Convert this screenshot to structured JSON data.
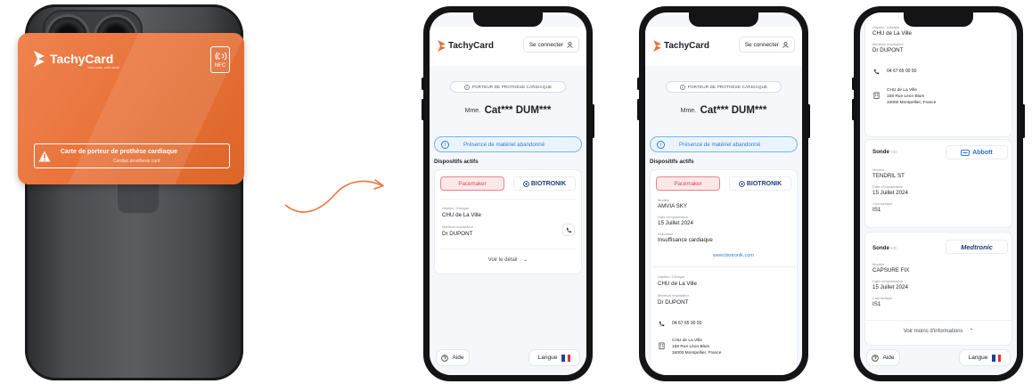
{
  "card": {
    "brand": "TachyCard",
    "tagline": "Votre carte, votre santé",
    "nfc_label": "NFC",
    "banner_title": "Carte de porteur de prothèse cardiaque",
    "banner_subtitle": "Cardiac prosthesis card"
  },
  "app": {
    "brand": "TachyCard",
    "login_label": "Se connecter",
    "chip_label": "PORTEUR DE PROTHÈSE CARDIAQUE",
    "patient_civility": "Mme.",
    "patient_name": "Cat*** DUM***",
    "alert_text": "Présence de matériel abandonné",
    "section_title": "Dispositifs actifs",
    "device_type": "Pacemaker",
    "manufacturer": "BIOTRONIK",
    "hospital_label": "Hôpital / Clinique",
    "hospital": "CHU de La Ville",
    "doctor_label": "Médecin implanteur",
    "doctor": "Dr DUPONT",
    "details_label": "Voir le détail",
    "model_label": "Modèle",
    "model": "AMVIA SKY",
    "implant_date_label": "Date d'implantation",
    "implant_date": "15 Juillet 2024",
    "indication_label": "Indication",
    "indication": "Insuffisance cardiaque",
    "website": "www.biotronik.com",
    "phone": "04 67 65 00 00",
    "address_line1": "CHU de La Ville",
    "address_line2": "158 Rue Léon Blum",
    "address_line3": "34000 Montpellier, France",
    "help_label": "Aide",
    "language_label": "Langue",
    "flag_colors": [
      "#1f3fa0",
      "#ffffff",
      "#e0313b"
    ]
  },
  "leads": [
    {
      "label": "Sonde",
      "suffix": "OD",
      "brand": "Abbott",
      "model_label": "Modèle",
      "model": "TENDRIL ST",
      "date_label": "Date d'implantation",
      "date": "15 Juillet 2024",
      "connector_label": "Connectique",
      "connector": "IS1"
    },
    {
      "label": "Sonde",
      "suffix": "VD",
      "brand": "Medtronic",
      "model_label": "Modèle",
      "model": "CAPSURE FIX",
      "date_label": "Date d'implantation",
      "date": "15 Juillet 2024",
      "connector_label": "Connectique",
      "connector": "IS1"
    }
  ],
  "less_info_label": "Voir moins d'informations",
  "colors": {
    "accent_orange": "#e9743c",
    "pacemaker_red": "#d94a4f",
    "link_blue": "#2f7fd0",
    "abbott_blue": "#2b6fd6",
    "medtronic_navy": "#1c3f7c"
  }
}
